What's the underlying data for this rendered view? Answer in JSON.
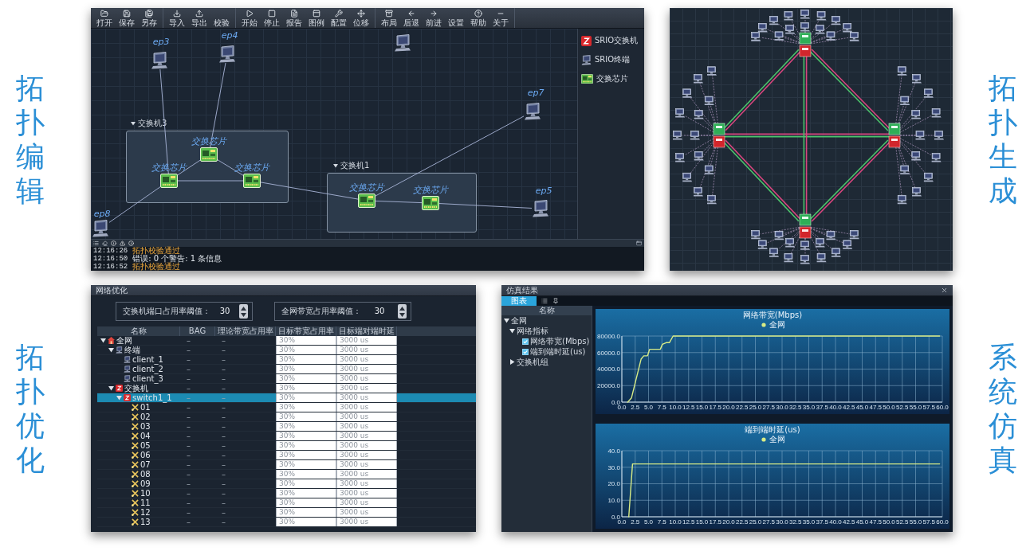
{
  "editor": {
    "caption": "拓扑编辑",
    "toolbar": [
      [
        "打开",
        "保存",
        "另存"
      ],
      [
        "导入",
        "导出",
        "校验"
      ],
      [
        "开始",
        "停止",
        "报告",
        "图例",
        "配置",
        "位移"
      ],
      [
        "布局",
        "后退",
        "前进",
        "设置",
        "帮助",
        "关于"
      ]
    ],
    "endpoints": [
      {
        "label": "ep3"
      },
      {
        "label": "ep4"
      },
      {
        "label": "ep7"
      },
      {
        "label": "ep5"
      },
      {
        "label": "ep8"
      }
    ],
    "groups": [
      {
        "title": "交换机3",
        "chips": [
          "交换芯片",
          "交换芯片",
          "交换芯片"
        ]
      },
      {
        "title": "交换机1",
        "chips": [
          "交换芯片",
          "交换芯片"
        ]
      }
    ],
    "palette": [
      {
        "label": "SRIO交换机",
        "kind": "switch"
      },
      {
        "label": "SRIO终端",
        "kind": "terminal"
      },
      {
        "label": "交换芯片",
        "kind": "chip"
      }
    ],
    "log": [
      {
        "time": "12:16:26",
        "message": "拓扑校验通过",
        "kind": "warning"
      },
      {
        "time": "12:16:50",
        "message": "错误: 0 个警告: 1 条信息",
        "kind": "info"
      },
      {
        "time": "12:16:52",
        "message": "拓扑校验通过",
        "kind": "warning"
      }
    ]
  },
  "generator": {
    "caption": "拓扑生成"
  },
  "optimizer": {
    "caption": "拓扑优化",
    "title": "网络优化",
    "thresholds": [
      {
        "label": "交换机端口占用率阈值：",
        "value": "30"
      },
      {
        "label": "全网带宽占用率阈值：",
        "value": "30"
      }
    ],
    "columns": [
      "名称",
      "BAG",
      "理论带宽占用率",
      "目标带宽占用率",
      "目标端对端时延"
    ],
    "rows": [
      {
        "name": "全网",
        "kind": "network",
        "expanded": true,
        "selected": false,
        "bag": "–",
        "theory": "–",
        "target_bandwidth": "30%",
        "target_latency": "3000 us",
        "children": [
          {
            "name": "终端",
            "kind": "terminal",
            "expanded": true,
            "selected": false,
            "bag": "–",
            "theory": "–",
            "target_bandwidth": "30%",
            "target_latency": "3000 us",
            "children": [
              {
                "name": "client_1",
                "kind": "terminal",
                "selected": false,
                "bag": "–",
                "theory": "–",
                "target_bandwidth": "30%",
                "target_latency": "3000 us"
              },
              {
                "name": "client_2",
                "kind": "terminal",
                "selected": false,
                "bag": "–",
                "theory": "–",
                "target_bandwidth": "30%",
                "target_latency": "3000 us"
              },
              {
                "name": "client_3",
                "kind": "terminal",
                "selected": false,
                "bag": "–",
                "theory": "–",
                "target_bandwidth": "30%",
                "target_latency": "3000 us"
              }
            ]
          },
          {
            "name": "交换机",
            "kind": "switch",
            "expanded": true,
            "selected": false,
            "bag": "–",
            "theory": "–",
            "target_bandwidth": "30%",
            "target_latency": "3000 us",
            "children": [
              {
                "name": "switch1_1",
                "kind": "switch",
                "expanded": true,
                "selected": true,
                "bag": "–",
                "theory": "–",
                "target_bandwidth": "30%",
                "target_latency": "3000 us",
                "children": [
                  {
                    "name": "01",
                    "kind": "port",
                    "selected": false,
                    "bag": "–",
                    "theory": "–",
                    "target_bandwidth": "30%",
                    "target_latency": "3000 us"
                  },
                  {
                    "name": "02",
                    "kind": "port",
                    "selected": false,
                    "bag": "–",
                    "theory": "–",
                    "target_bandwidth": "30%",
                    "target_latency": "3000 us"
                  },
                  {
                    "name": "03",
                    "kind": "port",
                    "selected": false,
                    "bag": "–",
                    "theory": "–",
                    "target_bandwidth": "30%",
                    "target_latency": "3000 us"
                  },
                  {
                    "name": "04",
                    "kind": "port",
                    "selected": false,
                    "bag": "–",
                    "theory": "–",
                    "target_bandwidth": "30%",
                    "target_latency": "3000 us"
                  },
                  {
                    "name": "05",
                    "kind": "port",
                    "selected": false,
                    "bag": "–",
                    "theory": "–",
                    "target_bandwidth": "30%",
                    "target_latency": "3000 us"
                  },
                  {
                    "name": "06",
                    "kind": "port",
                    "selected": false,
                    "bag": "–",
                    "theory": "–",
                    "target_bandwidth": "30%",
                    "target_latency": "3000 us"
                  },
                  {
                    "name": "07",
                    "kind": "port",
                    "selected": false,
                    "bag": "–",
                    "theory": "–",
                    "target_bandwidth": "30%",
                    "target_latency": "3000 us"
                  },
                  {
                    "name": "08",
                    "kind": "port",
                    "selected": false,
                    "bag": "–",
                    "theory": "–",
                    "target_bandwidth": "30%",
                    "target_latency": "3000 us"
                  },
                  {
                    "name": "09",
                    "kind": "port",
                    "selected": false,
                    "bag": "–",
                    "theory": "–",
                    "target_bandwidth": "30%",
                    "target_latency": "3000 us"
                  },
                  {
                    "name": "10",
                    "kind": "port",
                    "selected": false,
                    "bag": "–",
                    "theory": "–",
                    "target_bandwidth": "30%",
                    "target_latency": "3000 us"
                  },
                  {
                    "name": "11",
                    "kind": "port",
                    "selected": false,
                    "bag": "–",
                    "theory": "–",
                    "target_bandwidth": "30%",
                    "target_latency": "3000 us"
                  },
                  {
                    "name": "12",
                    "kind": "port",
                    "selected": false,
                    "bag": "–",
                    "theory": "–",
                    "target_bandwidth": "30%",
                    "target_latency": "3000 us"
                  },
                  {
                    "name": "13",
                    "kind": "port",
                    "selected": false,
                    "bag": "–",
                    "theory": "–",
                    "target_bandwidth": "30%",
                    "target_latency": "3000 us"
                  }
                ]
              }
            ]
          }
        ]
      }
    ]
  },
  "simulation": {
    "caption": "系统仿真",
    "title": "仿真结果",
    "tabs": [
      {
        "label": "图表",
        "selected": true
      }
    ],
    "tree_header": "名称",
    "tree": [
      {
        "label": "全网",
        "expanded": true,
        "children": [
          {
            "label": "网络指标",
            "expanded": true,
            "children": [
              {
                "label": "网络带宽(Mbps)",
                "checked": true
              },
              {
                "label": "端到端时延(us)",
                "checked": true
              }
            ]
          },
          {
            "label": "交换机组",
            "expanded": false
          }
        ]
      }
    ],
    "charts": [
      {
        "chart_data": {
          "type": "line",
          "title": "网络带宽(Mbps)",
          "x": [
            1.1,
            1.8,
            3.6,
            4.1,
            4.8,
            5.2,
            7.2,
            7.6,
            8.3,
            8.9,
            9.6,
            9.9,
            59.5
          ],
          "series": [
            {
              "name": "全网",
              "color": "#d8ec86",
              "values": [
                0,
                5000,
                52000,
                56000,
                56000,
                64000,
                64000,
                70000,
                72000,
                72000,
                80000,
                80000,
                80000
              ]
            }
          ],
          "xlim": [
            0,
            60
          ],
          "ylim": [
            0,
            80000
          ],
          "grid": true,
          "xticks": [
            {
              "value": 0,
              "label": "0.0"
            },
            {
              "value": 2.5,
              "label": "2.5"
            },
            {
              "value": 5,
              "label": "5.0"
            },
            {
              "value": 7.5,
              "label": "7.5"
            },
            {
              "value": 10,
              "label": "10.0"
            },
            {
              "value": 12.5,
              "label": "12.5"
            },
            {
              "value": 15,
              "label": "15.0"
            },
            {
              "value": 17.5,
              "label": "17.5"
            },
            {
              "value": 20,
              "label": "20.0"
            },
            {
              "value": 22.5,
              "label": "22.5"
            },
            {
              "value": 25,
              "label": "25.0"
            },
            {
              "value": 27.5,
              "label": "27.5"
            },
            {
              "value": 30,
              "label": "30.0"
            },
            {
              "value": 32.5,
              "label": "32.5"
            },
            {
              "value": 35,
              "label": "35.0"
            },
            {
              "value": 37.5,
              "label": "37.5"
            },
            {
              "value": 40,
              "label": "40.0"
            },
            {
              "value": 42.5,
              "label": "42.5"
            },
            {
              "value": 45,
              "label": "45.0"
            },
            {
              "value": 47.5,
              "label": "47.5"
            },
            {
              "value": 50,
              "label": "50.0"
            },
            {
              "value": 52.5,
              "label": "52.5"
            },
            {
              "value": 55,
              "label": "55.0"
            },
            {
              "value": 57.5,
              "label": "57.5"
            },
            {
              "value": 60,
              "label": "60.0"
            }
          ],
          "yticks": [
            {
              "value": 0,
              "label": "0.0"
            },
            {
              "value": 20000,
              "label": "20000.0"
            },
            {
              "value": 40000,
              "label": "40000.0"
            },
            {
              "value": 60000,
              "label": "60000.0"
            },
            {
              "value": 80000,
              "label": "80000.0"
            }
          ]
        }
      },
      {
        "chart_data": {
          "type": "line",
          "title": "端到端时延(us)",
          "x": [
            1.3,
            2.0,
            59.5
          ],
          "series": [
            {
              "name": "全网",
              "color": "#d8ec86",
              "values": [
                0,
                32,
                32
              ]
            }
          ],
          "xlim": [
            0,
            60
          ],
          "ylim": [
            0,
            40
          ],
          "grid": true,
          "xticks": [
            {
              "value": 0,
              "label": "0.0"
            },
            {
              "value": 2.5,
              "label": "2.5"
            },
            {
              "value": 5,
              "label": "5.0"
            },
            {
              "value": 7.5,
              "label": "7.5"
            },
            {
              "value": 10,
              "label": "10.0"
            },
            {
              "value": 12.5,
              "label": "12.5"
            },
            {
              "value": 15,
              "label": "15.0"
            },
            {
              "value": 17.5,
              "label": "17.5"
            },
            {
              "value": 20,
              "label": "20.0"
            },
            {
              "value": 22.5,
              "label": "22.5"
            },
            {
              "value": 25,
              "label": "25.0"
            },
            {
              "value": 27.5,
              "label": "27.5"
            },
            {
              "value": 30,
              "label": "30.0"
            },
            {
              "value": 32.5,
              "label": "32.5"
            },
            {
              "value": 35,
              "label": "35.0"
            },
            {
              "value": 37.5,
              "label": "37.5"
            },
            {
              "value": 40,
              "label": "40.0"
            },
            {
              "value": 42.5,
              "label": "42.5"
            },
            {
              "value": 45,
              "label": "45.0"
            },
            {
              "value": 47.5,
              "label": "47.5"
            },
            {
              "value": 50,
              "label": "50.0"
            },
            {
              "value": 52.5,
              "label": "52.5"
            },
            {
              "value": 55,
              "label": "55.0"
            },
            {
              "value": 57.5,
              "label": "57.5"
            },
            {
              "value": 60,
              "label": "60.0"
            }
          ],
          "yticks": [
            {
              "value": 0,
              "label": "0.0"
            },
            {
              "value": 10,
              "label": "10.0"
            },
            {
              "value": 20,
              "label": "20.0"
            },
            {
              "value": 30,
              "label": "30.0"
            },
            {
              "value": 40,
              "label": "40.0"
            }
          ]
        }
      }
    ]
  }
}
